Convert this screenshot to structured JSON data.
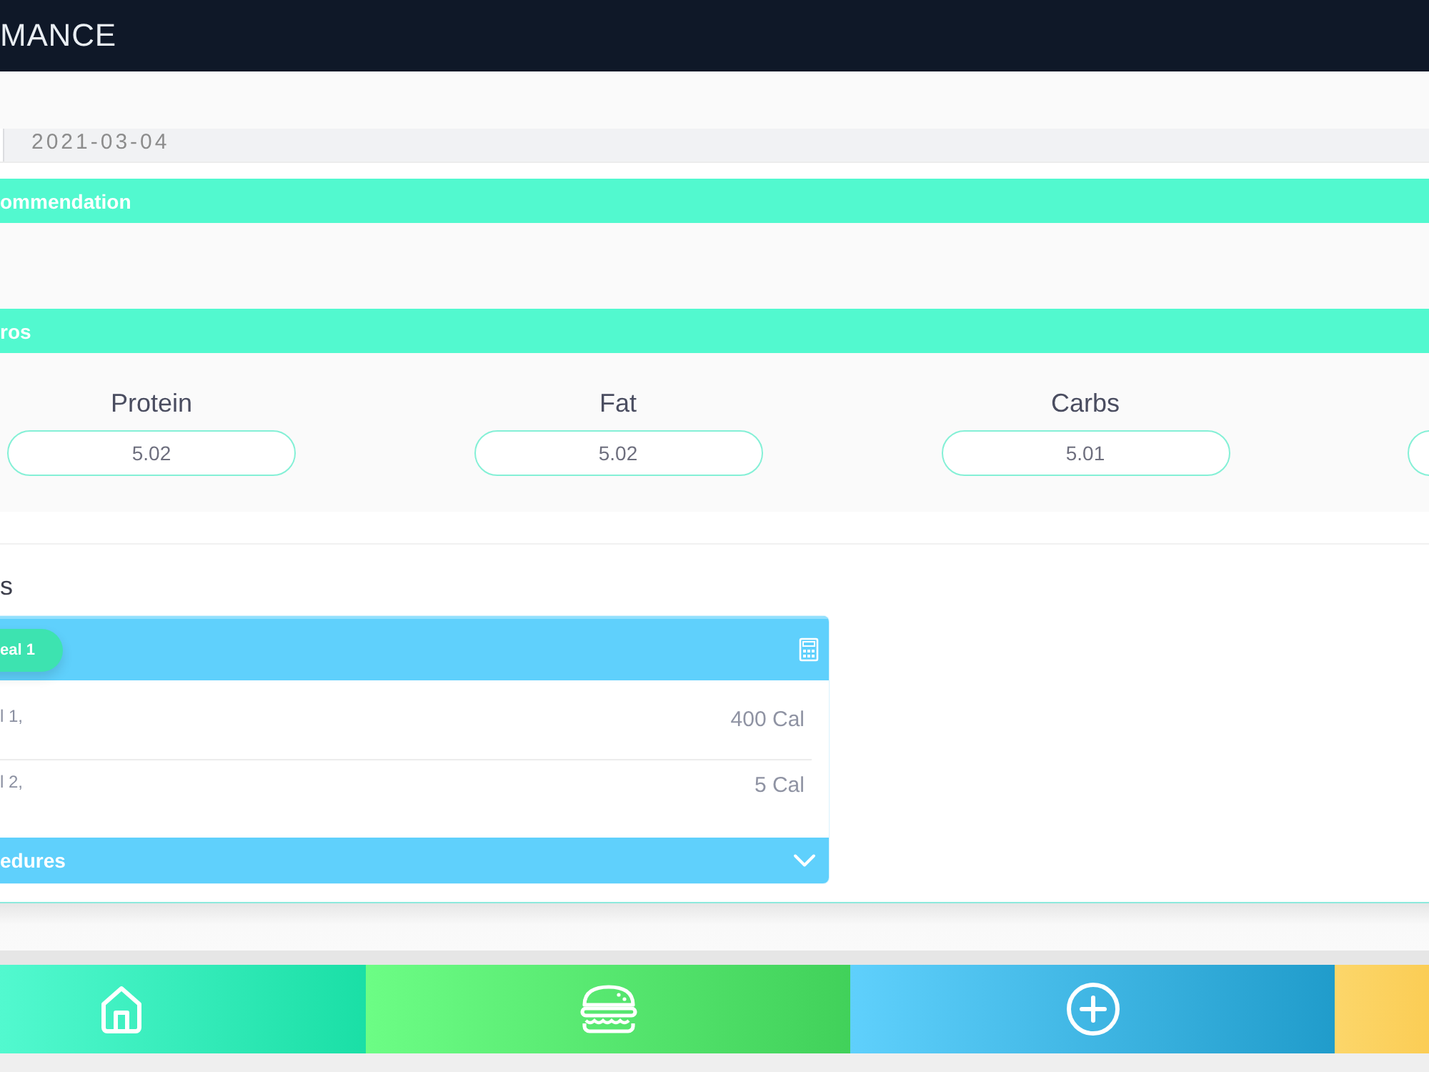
{
  "app_bar": {
    "title": "MANCE"
  },
  "date_field": {
    "value": "2021-03-04"
  },
  "sections": [
    {
      "title": "ommendation"
    },
    {
      "title": "ros",
      "macros": [
        {
          "kind": "field",
          "label": "Protein",
          "value": "5.02"
        },
        {
          "kind": "field",
          "label": "Fat",
          "value": "5.02"
        },
        {
          "kind": "field",
          "label": "Carbs",
          "value": "5.01"
        },
        {
          "kind": "cut"
        }
      ]
    }
  ],
  "meals_heading": "s",
  "meal_card": {
    "badge": "eal 1",
    "items": [
      {
        "name": "l 1,",
        "calories": "400 Cal"
      },
      {
        "name": "l 2,",
        "calories": "5 Cal"
      }
    ],
    "footer": {
      "label": "edures",
      "expanded": false
    }
  },
  "nav_bar": {
    "items": [
      {
        "kind": "home"
      },
      {
        "kind": "burger"
      },
      {
        "kind": "add"
      },
      {
        "kind": "cut"
      }
    ]
  }
}
